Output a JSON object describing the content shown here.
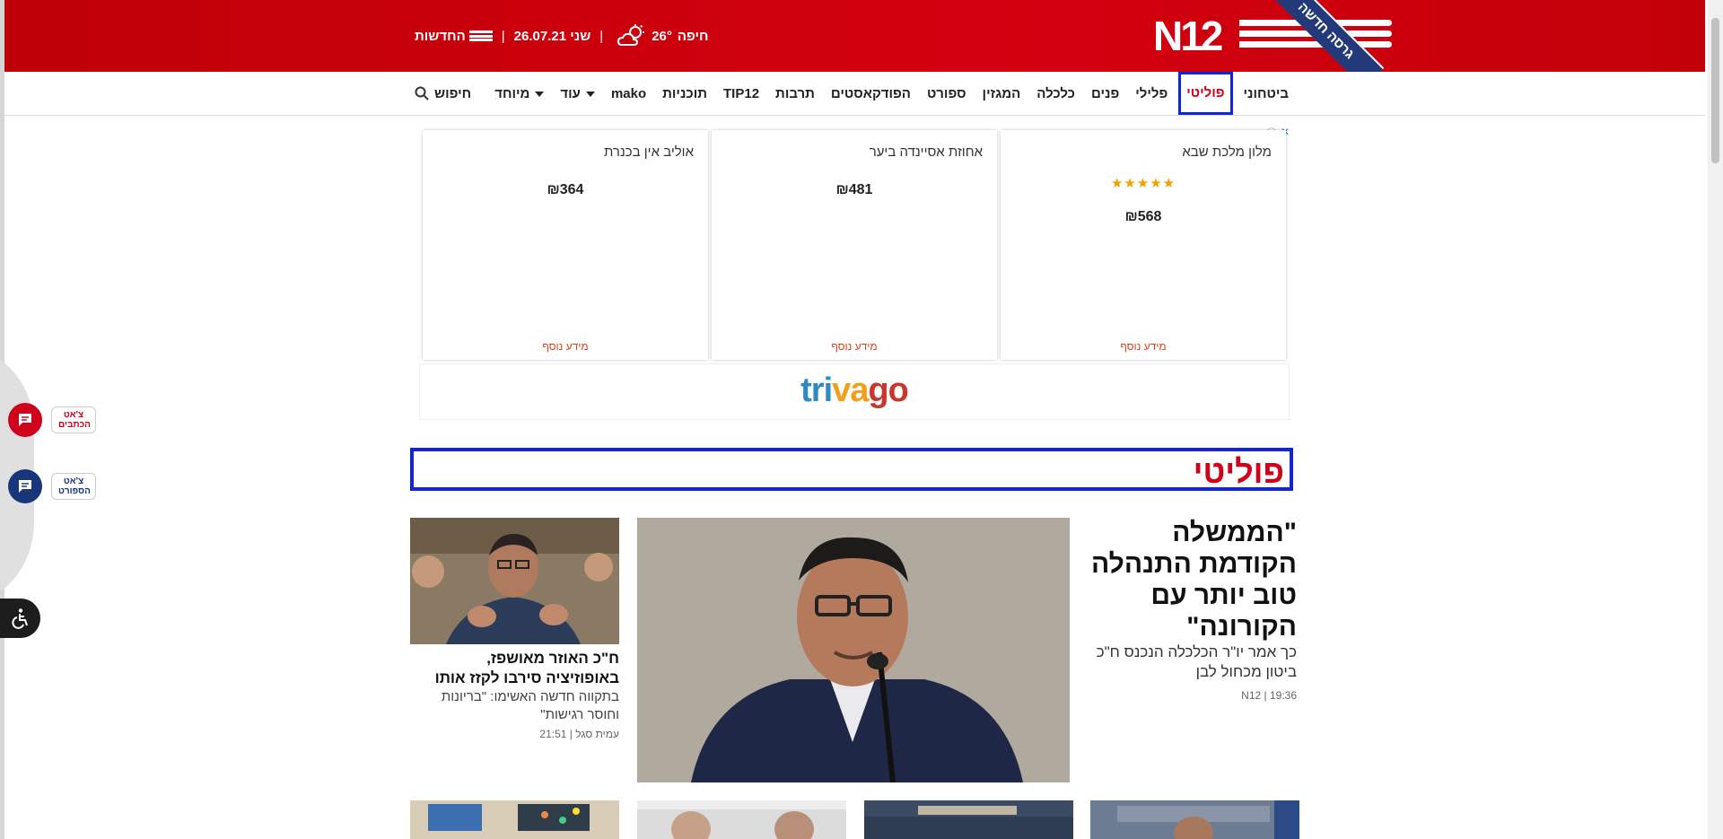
{
  "header": {
    "ribbon": "גרסה חדשה",
    "news_label": "החדשות",
    "date": "שני 26.07.21",
    "city": "חיפה",
    "temperature": "26°",
    "separator": "|",
    "weather_icon": "partly-cloudy-icon"
  },
  "nav": {
    "items": [
      {
        "label": "ביטחוני"
      },
      {
        "label": "פוליטי"
      },
      {
        "label": "פלילי"
      },
      {
        "label": "פנים"
      },
      {
        "label": "כלכלה"
      },
      {
        "label": "המגזין"
      },
      {
        "label": "ספורט"
      },
      {
        "label": "הפודקאסטים"
      },
      {
        "label": "תרבות"
      },
      {
        "label": "TIP12"
      },
      {
        "label": "תוכניות"
      },
      {
        "label": "mako"
      },
      {
        "label": "עוד"
      },
      {
        "label": "מיוחד"
      }
    ],
    "search_label": "חיפוש"
  },
  "ad": {
    "cards": [
      {
        "title": "מלון מלכת שבא",
        "stars": "★★★★★",
        "price": "₪568",
        "more": "מידע נוסף"
      },
      {
        "title": "אחוזת אסיינדה ביער",
        "price": "₪481",
        "more": "מידע נוסף"
      },
      {
        "title": "אוליב אין בכנרת",
        "price": "₪364",
        "more": "מידע נוסף"
      }
    ],
    "brand_part1": "tri",
    "brand_part2": "va",
    "brand_part3": "go",
    "info_icon": "ⓘ",
    "close_icon": "✕"
  },
  "section": {
    "title": "פוליטי"
  },
  "main_article": {
    "title": "\"הממשלה הקודמת התנהלה טוב יותר עם הקורונה\"",
    "subtitle": "כך אמר יו\"ר הכלכלה הנכנס ח\"כ ביטון מכחול לבן",
    "meta": "19:36 | N12"
  },
  "side_article": {
    "title": "ח\"כ האוזר מאושפז, באופוזיציה סירבו לקזז אותו",
    "subtitle": "בתקווה חדשה האשימו: \"בריונות וחוסר רגישות\"",
    "meta": "עמית סגל | 21:51"
  },
  "floating": {
    "chat_writers": "צ'אט הכתבים",
    "chat_sports": "צ'אט הספורט"
  }
}
